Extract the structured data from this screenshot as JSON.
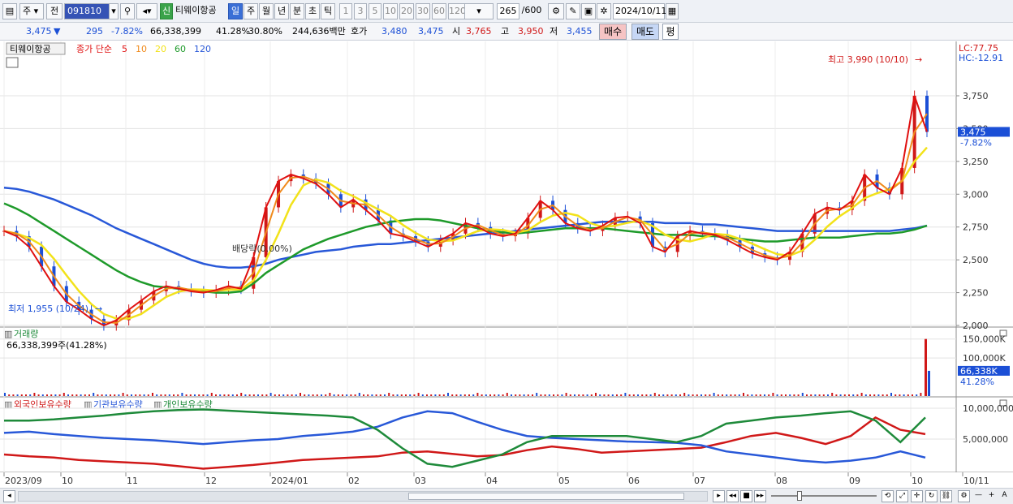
{
  "toolbar": {
    "period_type": "주",
    "prev_label": "전",
    "code": "091810",
    "stock_name_badge": "신",
    "stock_name": "티웨이항공",
    "tabs": [
      "일",
      "주",
      "월",
      "년",
      "분",
      "초",
      "틱"
    ],
    "active_tab": "일",
    "intervals": [
      "1",
      "3",
      "5",
      "10",
      "20",
      "30",
      "60",
      "120"
    ],
    "count": "265",
    "count_total": "/600",
    "date": "2024/10/11"
  },
  "quote": {
    "price": "3,475",
    "change_arrow": "▼",
    "change": "295",
    "change_pct": "-7.82%",
    "volume": "66,338,399",
    "vol_ratio": "41.28%",
    "turnover_pct": "30.80%",
    "amount": "244,636백만",
    "hoga_label": "호가",
    "ask": "3,480",
    "bid": "3,475",
    "open_label": "시",
    "open": "3,765",
    "high_label": "고",
    "high": "3,950",
    "low_label": "저",
    "low": "3,455",
    "buy_label": "매수",
    "sell_label": "매도",
    "avg_label": "평"
  },
  "legend": {
    "name": "티웨이항공",
    "ma_label": "종가 단순",
    "ma_periods": [
      "5",
      "10",
      "20",
      "60",
      "120"
    ],
    "ma_colors": [
      "#e01010",
      "#f08a1c",
      "#f2e21a",
      "#1e9a2a",
      "#2858d8"
    ]
  },
  "price_panel": {
    "lc_label": "LC:77.75",
    "hc_label": "HC:-12.91",
    "high_note": "최고 3,990 (10/10)",
    "low_note": "최저 1,955 (10/24)",
    "dividend_note": "배당락(0.00%)",
    "current_label": "3,475",
    "current_pct": "-7.82%",
    "y_ticks": [
      "3,750",
      "3,500",
      "3,250",
      "3,000",
      "2,750",
      "2,500",
      "2,250",
      "2,000"
    ]
  },
  "volume_panel": {
    "title": "거래량",
    "info": "66,338,399주(41.28%)",
    "y_ticks": [
      "150,000K",
      "100,000K"
    ],
    "current_label": "66,338K",
    "current_pct": "41.28%"
  },
  "holding_panel": {
    "series": [
      "외국인보유수량",
      "기관보유수량",
      "개인보유수량"
    ],
    "series_colors": [
      "#d01818",
      "#2858d8",
      "#1e8a3a"
    ],
    "y_ticks": [
      "10,000,000",
      "5,000,000"
    ]
  },
  "x_axis": {
    "labels": [
      "2023/09",
      "10",
      "11",
      "12",
      "2024/01",
      "02",
      "03",
      "04",
      "05",
      "06",
      "07",
      "08",
      "09",
      "10",
      "10/11"
    ]
  },
  "chart_data": {
    "type": "candlestick",
    "price_range": [
      1900,
      4000
    ],
    "close_weekly": [
      2720,
      2680,
      2600,
      2450,
      2300,
      2180,
      2120,
      2050,
      2000,
      2040,
      2120,
      2190,
      2260,
      2300,
      2280,
      2260,
      2250,
      2270,
      2300,
      2280,
      2520,
      2900,
      3100,
      3150,
      3120,
      3080,
      3000,
      2900,
      2960,
      2880,
      2800,
      2700,
      2680,
      2640,
      2600,
      2650,
      2700,
      2780,
      2750,
      2700,
      2680,
      2700,
      2820,
      2950,
      2880,
      2780,
      2740,
      2720,
      2760,
      2820,
      2830,
      2780,
      2600,
      2560,
      2680,
      2720,
      2700,
      2690,
      2650,
      2600,
      2550,
      2520,
      2500,
      2560,
      2700,
      2850,
      2900,
      2880,
      2950,
      3150,
      3050,
      3000,
      3200,
      3750,
      3475
    ],
    "ma120": [
      3050,
      3040,
      3020,
      2990,
      2960,
      2920,
      2880,
      2840,
      2790,
      2740,
      2700,
      2660,
      2620,
      2580,
      2540,
      2500,
      2470,
      2450,
      2440,
      2440,
      2450,
      2470,
      2500,
      2520,
      2540,
      2560,
      2570,
      2580,
      2600,
      2610,
      2620,
      2620,
      2630,
      2640,
      2650,
      2660,
      2670,
      2680,
      2690,
      2700,
      2710,
      2720,
      2730,
      2740,
      2750,
      2760,
      2770,
      2780,
      2790,
      2790,
      2790,
      2790,
      2790,
      2780,
      2780,
      2780,
      2770,
      2770,
      2760,
      2750,
      2740,
      2730,
      2720,
      2720,
      2720,
      2720,
      2720,
      2720,
      2720,
      2720,
      2720,
      2720,
      2730,
      2740,
      2760
    ],
    "ma60": [
      2930,
      2890,
      2840,
      2780,
      2720,
      2660,
      2600,
      2540,
      2480,
      2420,
      2370,
      2330,
      2300,
      2290,
      2280,
      2270,
      2260,
      2250,
      2250,
      2260,
      2320,
      2400,
      2460,
      2520,
      2580,
      2620,
      2660,
      2690,
      2720,
      2750,
      2770,
      2790,
      2800,
      2810,
      2810,
      2800,
      2780,
      2760,
      2740,
      2720,
      2710,
      2700,
      2710,
      2720,
      2730,
      2740,
      2740,
      2740,
      2740,
      2730,
      2720,
      2710,
      2700,
      2690,
      2690,
      2690,
      2680,
      2680,
      2670,
      2660,
      2650,
      2640,
      2640,
      2650,
      2660,
      2670,
      2670,
      2670,
      2680,
      2690,
      2700,
      2700,
      2710,
      2730,
      2760
    ],
    "volume_last": 150000,
    "holding": {
      "foreign": [
        0.25,
        0.22,
        0.2,
        0.16,
        0.14,
        0.12,
        0.1,
        0.06,
        0.02,
        0.05,
        0.08,
        0.12,
        0.16,
        0.18,
        0.2,
        0.22,
        0.28,
        0.3,
        0.26,
        0.22,
        0.24,
        0.32,
        0.38,
        0.34,
        0.28,
        0.3,
        0.32,
        0.34,
        0.36,
        0.45,
        0.55,
        0.6,
        0.52,
        0.42,
        0.55,
        0.85,
        0.65,
        0.58
      ],
      "institution": [
        0.6,
        0.62,
        0.58,
        0.55,
        0.52,
        0.5,
        0.48,
        0.45,
        0.42,
        0.45,
        0.48,
        0.5,
        0.55,
        0.58,
        0.62,
        0.7,
        0.85,
        0.95,
        0.92,
        0.78,
        0.65,
        0.55,
        0.52,
        0.5,
        0.48,
        0.46,
        0.45,
        0.44,
        0.4,
        0.3,
        0.25,
        0.2,
        0.15,
        0.12,
        0.15,
        0.2,
        0.3,
        0.2
      ],
      "individual": [
        0.8,
        0.8,
        0.82,
        0.85,
        0.88,
        0.92,
        0.95,
        0.97,
        0.98,
        0.96,
        0.94,
        0.92,
        0.9,
        0.88,
        0.85,
        0.65,
        0.35,
        0.1,
        0.05,
        0.15,
        0.25,
        0.45,
        0.55,
        0.55,
        0.55,
        0.55,
        0.5,
        0.45,
        0.55,
        0.75,
        0.8,
        0.85,
        0.88,
        0.92,
        0.95,
        0.8,
        0.45,
        0.85
      ]
    }
  }
}
